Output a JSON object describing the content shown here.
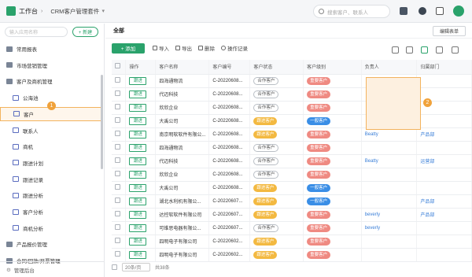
{
  "topbar": {
    "workspace": "工作台",
    "app_name": "CRM客户管理套件",
    "search_placeholder": "搜索客户、联系人"
  },
  "sidebar": {
    "search_placeholder": "输入应用名称",
    "new_label": "+ 新建",
    "items": [
      {
        "label": "常用报表",
        "type": "folder"
      },
      {
        "label": "市场营销管理",
        "type": "folder"
      },
      {
        "label": "客户及商机管理",
        "type": "folder"
      },
      {
        "label": "公海池",
        "type": "child"
      },
      {
        "label": "客户",
        "type": "child",
        "active": true
      },
      {
        "label": "联系人",
        "type": "child"
      },
      {
        "label": "商机",
        "type": "child"
      },
      {
        "label": "跟进计划",
        "type": "child"
      },
      {
        "label": "跟进记录",
        "type": "child"
      },
      {
        "label": "跟进分析",
        "type": "child"
      },
      {
        "label": "客户分析",
        "type": "child"
      },
      {
        "label": "商机分析",
        "type": "child"
      },
      {
        "label": "产品报价管理",
        "type": "folder"
      },
      {
        "label": "合同/回款/开票管理",
        "type": "folder"
      }
    ],
    "badge_1": "1",
    "footer": "管理后台"
  },
  "main": {
    "tab": "全部",
    "edit_form": "编辑表单",
    "add_label": "+ 添加",
    "toolbar": [
      "导入",
      "导出",
      "删除",
      "操作记录"
    ],
    "badge_2": "2",
    "columns": [
      "操作",
      "客户名称",
      "客户编号",
      "客户状态",
      "客户级别",
      "负责人",
      "归属部门"
    ],
    "rows": [
      {
        "action": "跟进",
        "name": "四海通物流",
        "code": "C-20220608...",
        "status": "合作客户",
        "status_t": "hz",
        "level": "重要客户",
        "level_t": "red",
        "owner": "",
        "dept": ""
      },
      {
        "action": "跟进",
        "name": "代迈科技",
        "code": "C-20220608...",
        "status": "合作客户",
        "status_t": "hz",
        "level": "重要客户",
        "level_t": "red",
        "owner": "",
        "dept": ""
      },
      {
        "action": "跟进",
        "name": "欣欣企业",
        "code": "C-20220608...",
        "status": "合作客户",
        "status_t": "hz",
        "level": "重要客户",
        "level_t": "red",
        "owner": "",
        "dept": ""
      },
      {
        "action": "跟进",
        "name": "大禹公司",
        "code": "C-20220608...",
        "status": "跟进客户",
        "status_t": "gj",
        "level": "一般客户",
        "level_t": "blue",
        "owner": "",
        "dept": ""
      },
      {
        "action": "跟进",
        "name": "南京明软软件有限公...",
        "code": "C-20220608...",
        "status": "跟进客户",
        "status_t": "gj",
        "level": "重要客户",
        "level_t": "red",
        "owner": "Beatty",
        "dept": "产品部"
      },
      {
        "action": "跟进",
        "name": "四海通物流",
        "code": "C-20220608...",
        "status": "合作客户",
        "status_t": "hz",
        "level": "重要客户",
        "level_t": "red",
        "owner": "",
        "dept": ""
      },
      {
        "action": "跟进",
        "name": "代迈科技",
        "code": "C-20220608...",
        "status": "合作客户",
        "status_t": "hz",
        "level": "重要客户",
        "level_t": "red",
        "owner": "Beatty",
        "dept": "运营部"
      },
      {
        "action": "跟进",
        "name": "欣欣企业",
        "code": "C-20220608...",
        "status": "合作客户",
        "status_t": "hz",
        "level": "重要客户",
        "level_t": "red",
        "owner": "",
        "dept": ""
      },
      {
        "action": "跟进",
        "name": "大禹公司",
        "code": "C-20220608...",
        "status": "跟进客户",
        "status_t": "gj",
        "level": "一般客户",
        "level_t": "blue",
        "owner": "",
        "dept": ""
      },
      {
        "action": "跟进",
        "name": "湖北水利机有限公...",
        "code": "C-20220607...",
        "status": "跟进客户",
        "status_t": "gj",
        "level": "一般客户",
        "level_t": "blue",
        "owner": "",
        "dept": "产品部"
      },
      {
        "action": "跟进",
        "name": "达控软软件有限公司",
        "code": "C-20220607...",
        "status": "跟进客户",
        "status_t": "gj",
        "level": "重要客户",
        "level_t": "red",
        "owner": "beverly",
        "dept": "产品部"
      },
      {
        "action": "跟进",
        "name": "可维思电器有限公...",
        "code": "C-20220607...",
        "status": "合作客户",
        "status_t": "hz",
        "level": "重要客户",
        "level_t": "red",
        "owner": "beverly",
        "dept": ""
      },
      {
        "action": "跟进",
        "name": "四明电子有限公司",
        "code": "C-20220602...",
        "status": "跟进客户",
        "status_t": "gj",
        "level": "重要客户",
        "level_t": "red",
        "owner": "",
        "dept": ""
      },
      {
        "action": "跟进",
        "name": "四明电子有限公司",
        "code": "C-20220602...",
        "status": "跟进客户",
        "status_t": "gj",
        "level": "重要客户",
        "level_t": "red",
        "owner": "",
        "dept": ""
      }
    ],
    "pager": {
      "per_page": "20条/页",
      "total": "共38条"
    }
  }
}
